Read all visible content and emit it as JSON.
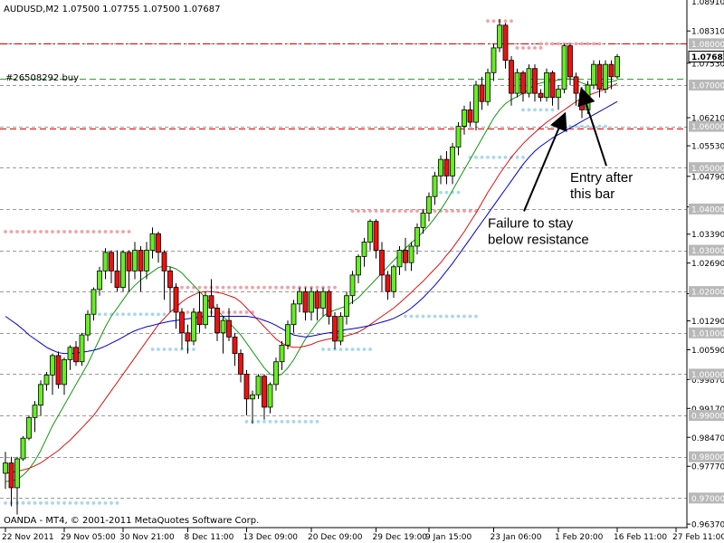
{
  "chart_data": {
    "type": "candlestick",
    "symbol_header": "AUDUSD,M2  1.07500 1.07755 1.07500 1.07687",
    "order_label": "#26508292 buy",
    "copyright": "OANDA - MT4, © 2001-2011 MetaQuotes Software Corp.",
    "ylim": [
      0.9635,
      1.0895
    ],
    "price_ticks": [
      "1.08310",
      "1.07530",
      "1.06210",
      "1.05530",
      "1.04790",
      "1.04050",
      "1.03390",
      "1.02690",
      "1.01950",
      "1.01290",
      "1.00590",
      "0.99870",
      "0.99170",
      "0.98470",
      "0.97770",
      "0.96370"
    ],
    "level_labels": [
      "1.08000",
      "1.07000",
      "1.06000",
      "1.05000",
      "1.04000",
      "1.03000",
      "1.02000",
      "1.01000",
      "1.00000",
      "0.99000",
      "0.98000",
      "0.97000"
    ],
    "current_price": "1.07687",
    "top_cut_label": "1.08910",
    "date_labels": [
      "22 Nov 2011",
      "29 Nov 05:00",
      "30 Nov 21:00",
      "8 Dec 11:00",
      "13 Dec 09:00",
      "20 Dec 09:00",
      "29 Dec 19:00",
      "9 Jan 15:00",
      "23 Jan 06:00",
      "1 Feb 20:00",
      "16 Feb 11:00",
      "27 Feb 11:00"
    ],
    "date_label_bars": [
      0,
      10,
      20,
      31,
      41,
      52,
      63,
      72,
      83,
      94,
      104,
      114
    ],
    "horizontal_levels": [
      {
        "price": 1.08,
        "style": "dashdot",
        "color": "#cc0000"
      },
      {
        "price": 1.0715,
        "style": "dashed",
        "color": "#22aa22"
      },
      {
        "price": 1.0595,
        "style": "dashed",
        "color": "#dd0000"
      }
    ],
    "candles": [
      [
        0.976,
        0.9812,
        0.9722,
        0.9785
      ],
      [
        0.9785,
        0.98,
        0.968,
        0.9725
      ],
      [
        0.9725,
        0.98,
        0.966,
        0.9795
      ],
      [
        0.9795,
        0.985,
        0.979,
        0.9845
      ],
      [
        0.9845,
        0.99,
        0.984,
        0.9895
      ],
      [
        0.9895,
        0.9935,
        0.986,
        0.9925
      ],
      [
        0.9925,
        0.9985,
        0.99,
        0.9975
      ],
      [
        0.9975,
        1.0005,
        0.996,
        0.9998
      ],
      [
        0.9998,
        1.005,
        0.995,
        1.0045
      ],
      [
        1.0045,
        1.0055,
        0.9965,
        0.9975
      ],
      [
        0.9975,
        1.004,
        0.995,
        1.0035
      ],
      [
        1.0035,
        1.007,
        1.001,
        1.0065
      ],
      [
        1.0065,
        1.008,
        1.002,
        1.003
      ],
      [
        1.003,
        1.01,
        1.002,
        1.0095
      ],
      [
        1.0095,
        1.0155,
        1.008,
        1.0145
      ],
      [
        1.0145,
        1.021,
        1.013,
        1.0205
      ],
      [
        1.0205,
        1.026,
        1.019,
        1.025
      ],
      [
        1.025,
        1.0305,
        1.023,
        1.0295
      ],
      [
        1.0295,
        1.03,
        1.022,
        1.025
      ],
      [
        1.025,
        1.03,
        1.02,
        1.021
      ],
      [
        1.021,
        1.03,
        1.02,
        1.0295
      ],
      [
        1.0295,
        1.03,
        1.02,
        1.025
      ],
      [
        1.025,
        1.032,
        1.023,
        1.03
      ],
      [
        1.03,
        1.031,
        1.02,
        1.025
      ],
      [
        1.025,
        1.032,
        1.023,
        1.03
      ],
      [
        1.03,
        1.0355,
        1.028,
        1.034
      ],
      [
        1.034,
        1.0345,
        1.027,
        1.0295
      ],
      [
        1.0295,
        1.03,
        1.018,
        1.025
      ],
      [
        1.025,
        1.026,
        1.015,
        1.021
      ],
      [
        1.021,
        1.022,
        1.011,
        1.015
      ],
      [
        1.015,
        1.016,
        1.006,
        1.01
      ],
      [
        1.01,
        1.012,
        1.005,
        1.008
      ],
      [
        1.008,
        1.016,
        1.007,
        1.015
      ],
      [
        1.015,
        1.02,
        1.01,
        1.012
      ],
      [
        1.012,
        1.02,
        1.011,
        1.019
      ],
      [
        1.019,
        1.023,
        1.014,
        1.016
      ],
      [
        1.016,
        1.017,
        1.008,
        1.01
      ],
      [
        1.01,
        1.014,
        1.005,
        1.013
      ],
      [
        1.013,
        1.016,
        1.008,
        1.009
      ],
      [
        1.009,
        1.01,
        1.002,
        1.005
      ],
      [
        1.005,
        1.006,
        0.998,
        1.0
      ],
      [
        1.0,
        1.001,
        0.99,
        0.994
      ],
      [
        0.994,
        0.996,
        0.988,
        0.995
      ],
      [
        0.995,
        1.0,
        0.994,
        0.9995
      ],
      [
        0.9995,
        1.0,
        0.989,
        0.992
      ],
      [
        0.992,
        0.998,
        0.9905,
        0.9975
      ],
      [
        0.9975,
        1.004,
        0.996,
        1.003
      ],
      [
        1.003,
        1.008,
        1.001,
        1.007
      ],
      [
        1.007,
        1.013,
        1.006,
        1.012
      ],
      [
        1.012,
        1.018,
        1.01,
        1.017
      ],
      [
        1.017,
        1.021,
        1.015,
        1.02
      ],
      [
        1.02,
        1.021,
        1.013,
        1.015
      ],
      [
        1.015,
        1.021,
        1.013,
        1.02
      ],
      [
        1.02,
        1.0205,
        1.013,
        1.016
      ],
      [
        1.016,
        1.021,
        1.014,
        1.02
      ],
      [
        1.02,
        1.0205,
        1.012,
        1.014
      ],
      [
        1.014,
        1.015,
        1.006,
        1.008
      ],
      [
        1.008,
        1.015,
        1.007,
        1.014
      ],
      [
        1.014,
        1.02,
        1.012,
        1.019
      ],
      [
        1.019,
        1.025,
        1.017,
        1.024
      ],
      [
        1.024,
        1.029,
        1.022,
        1.0285
      ],
      [
        1.0285,
        1.033,
        1.026,
        1.032
      ],
      [
        1.032,
        1.0375,
        1.03,
        1.037
      ],
      [
        1.037,
        1.0375,
        1.028,
        1.03
      ],
      [
        1.03,
        1.032,
        1.02,
        1.024
      ],
      [
        1.024,
        1.025,
        1.018,
        1.02
      ],
      [
        1.02,
        1.0265,
        1.0185,
        1.026
      ],
      [
        1.026,
        1.031,
        1.024,
        1.03
      ],
      [
        1.03,
        1.033,
        1.025,
        1.027
      ],
      [
        1.027,
        1.032,
        1.025,
        1.031
      ],
      [
        1.031,
        1.0365,
        1.029,
        1.0355
      ],
      [
        1.0355,
        1.04,
        1.034,
        1.039
      ],
      [
        1.039,
        1.044,
        1.037,
        1.043
      ],
      [
        1.043,
        1.049,
        1.041,
        1.048
      ],
      [
        1.048,
        1.053,
        1.046,
        1.052
      ],
      [
        1.052,
        1.054,
        1.046,
        1.048
      ],
      [
        1.048,
        1.056,
        1.046,
        1.055
      ],
      [
        1.055,
        1.061,
        1.053,
        1.06
      ],
      [
        1.06,
        1.065,
        1.058,
        1.064
      ],
      [
        1.064,
        1.066,
        1.06,
        1.061
      ],
      [
        1.061,
        1.071,
        1.059,
        1.07
      ],
      [
        1.07,
        1.072,
        1.064,
        1.066
      ],
      [
        1.066,
        1.074,
        1.065,
        1.073
      ],
      [
        1.073,
        1.08,
        1.071,
        1.079
      ],
      [
        1.079,
        1.086,
        1.078,
        1.0845
      ],
      [
        1.0845,
        1.085,
        1.074,
        1.076
      ],
      [
        1.076,
        1.077,
        1.065,
        1.068
      ],
      [
        1.068,
        1.074,
        1.067,
        1.073
      ],
      [
        1.073,
        1.0735,
        1.066,
        1.068
      ],
      [
        1.068,
        1.075,
        1.067,
        1.074
      ],
      [
        1.074,
        1.075,
        1.066,
        1.068
      ],
      [
        1.068,
        1.069,
        1.066,
        1.067
      ],
      [
        1.067,
        1.074,
        1.066,
        1.073
      ],
      [
        1.073,
        1.0735,
        1.065,
        1.067
      ],
      [
        1.067,
        1.07,
        1.064,
        1.069
      ],
      [
        1.069,
        1.08,
        1.068,
        1.0795
      ],
      [
        1.0795,
        1.08,
        1.07,
        1.072
      ],
      [
        1.072,
        1.073,
        1.065,
        1.068
      ],
      [
        1.068,
        1.0695,
        1.062,
        1.064
      ],
      [
        1.064,
        1.071,
        1.063,
        1.07
      ],
      [
        1.07,
        1.076,
        1.069,
        1.075
      ],
      [
        1.075,
        1.076,
        1.067,
        1.069
      ],
      [
        1.069,
        1.076,
        1.068,
        1.075
      ],
      [
        1.075,
        1.076,
        1.069,
        1.072
      ],
      [
        1.072,
        1.0775,
        1.0715,
        1.0769
      ]
    ],
    "ma_series": [
      {
        "color": "#119911",
        "values": [
          0.974,
          0.9742,
          0.9745,
          0.9755,
          0.977,
          0.979,
          0.9815,
          0.9845,
          0.9875,
          0.99,
          0.9925,
          0.995,
          0.9975,
          1.0,
          1.0025,
          1.0055,
          1.0085,
          1.0115,
          1.014,
          1.016,
          1.018,
          1.02,
          1.0215,
          1.0228,
          1.0238,
          1.0248,
          1.0258,
          1.0262,
          1.026,
          1.0255,
          1.0245,
          1.023,
          1.0215,
          1.02,
          1.0185,
          1.017,
          1.0155,
          1.014,
          1.0125,
          1.011,
          1.0095,
          1.0075,
          1.0055,
          1.0035,
          1.0015,
          1.0,
          0.9995,
          1.0,
          1.0015,
          1.0035,
          1.006,
          1.0085,
          1.0105,
          1.0125,
          1.014,
          1.015,
          1.0155,
          1.016,
          1.0165,
          1.0175,
          1.0185,
          1.02,
          1.0215,
          1.023,
          1.0245,
          1.026,
          1.0275,
          1.029,
          1.0305,
          1.0318,
          1.033,
          1.0345,
          1.036,
          1.0378,
          1.0398,
          1.042,
          1.0445,
          1.047,
          1.0495,
          1.052,
          1.0545,
          1.057,
          1.0595,
          1.062,
          1.064,
          1.0655,
          1.0665,
          1.0672,
          1.068,
          1.069,
          1.07,
          1.0705,
          1.0708,
          1.071,
          1.0712,
          1.0715,
          1.0715,
          1.0712,
          1.0705,
          1.07,
          1.07,
          1.0702,
          1.0705,
          1.0708,
          1.0712
        ]
      },
      {
        "color": "#dd1111",
        "values": [
          0.976,
          0.9762,
          0.9765,
          0.9768,
          0.9772,
          0.9778,
          0.9785,
          0.9795,
          0.9805,
          0.9815,
          0.9828,
          0.984,
          0.9855,
          0.987,
          0.9885,
          0.99,
          0.992,
          0.994,
          0.996,
          0.998,
          1.0,
          1.002,
          1.004,
          1.006,
          1.008,
          1.01,
          1.012,
          1.0135,
          1.015,
          1.0162,
          1.0175,
          1.0185,
          1.0192,
          1.0198,
          1.02,
          1.02,
          1.0198,
          1.0195,
          1.019,
          1.0185,
          1.0175,
          1.016,
          1.0145,
          1.013,
          1.0115,
          1.01,
          1.0085,
          1.0075,
          1.0068,
          1.0065,
          1.0065,
          1.0068,
          1.0072,
          1.0078,
          1.0082,
          1.0085,
          1.0088,
          1.009,
          1.0093,
          1.0097,
          1.0102,
          1.011,
          1.012,
          1.013,
          1.014,
          1.015,
          1.016,
          1.0172,
          1.0185,
          1.0198,
          1.0212,
          1.0225,
          1.024,
          1.0255,
          1.027,
          1.0288,
          1.0305,
          1.0325,
          1.0345,
          1.0368,
          1.039,
          1.0415,
          1.044,
          1.0462,
          1.0485,
          1.0505,
          1.0525,
          1.0542,
          1.0558,
          1.0572,
          1.0585,
          1.0598,
          1.061,
          1.062,
          1.063,
          1.064,
          1.065,
          1.066,
          1.0668,
          1.0675,
          1.068,
          1.0685,
          1.069,
          1.0697,
          1.0704
        ]
      },
      {
        "color": "#0000cc",
        "values": [
          1.014,
          1.013,
          1.012,
          1.0108,
          1.0095,
          1.0085,
          1.0075,
          1.0065,
          1.0058,
          1.0052,
          1.005,
          1.005,
          1.0051,
          1.0053,
          1.0055,
          1.0058,
          1.0062,
          1.0068,
          1.0075,
          1.0082,
          1.009,
          1.0098,
          1.0105,
          1.011,
          1.0115,
          1.0118,
          1.0122,
          1.0125,
          1.0128,
          1.013,
          1.0132,
          1.0134,
          1.0136,
          1.0138,
          1.014,
          1.014,
          1.014,
          1.014,
          1.014,
          1.014,
          1.014,
          1.014,
          1.0138,
          1.0135,
          1.013,
          1.0125,
          1.0118,
          1.011,
          1.0102,
          1.0095,
          1.0092,
          1.009,
          1.0092,
          1.0095,
          1.0098,
          1.01,
          1.0102,
          1.0105,
          1.0108,
          1.011,
          1.0112,
          1.0115,
          1.0118,
          1.0122,
          1.0126,
          1.013,
          1.0135,
          1.0142,
          1.015,
          1.016,
          1.0172,
          1.0185,
          1.02,
          1.0215,
          1.0232,
          1.025,
          1.0268,
          1.0288,
          1.0308,
          1.0328,
          1.0348,
          1.0368,
          1.0388,
          1.0408,
          1.0428,
          1.0448,
          1.0468,
          1.0488,
          1.0508,
          1.0525,
          1.054,
          1.0552,
          1.0562,
          1.0572,
          1.058,
          1.0588,
          1.0596,
          1.0604,
          1.0612,
          1.062,
          1.0628,
          1.0636,
          1.0644,
          1.0652,
          1.066
        ]
      }
    ],
    "dotted_levels": [
      {
        "price": 1.0345,
        "from": 0,
        "to": 21,
        "color": "#f4a0a8"
      },
      {
        "price": 1.0145,
        "from": 16,
        "to": 27,
        "color": "#a8d8ea"
      },
      {
        "price": 1.021,
        "from": 28,
        "to": 50,
        "color": "#f4a0a8"
      },
      {
        "price": 1.006,
        "from": 25,
        "to": 32,
        "color": "#a8d8ea"
      },
      {
        "price": 1.015,
        "from": 30,
        "to": 42,
        "color": "#f4a0a8"
      },
      {
        "price": 0.9885,
        "from": 41,
        "to": 53,
        "color": "#a8d8ea"
      },
      {
        "price": 1.021,
        "from": 48,
        "to": 56,
        "color": "#f4a0a8"
      },
      {
        "price": 1.006,
        "from": 54,
        "to": 62,
        "color": "#a8d8ea"
      },
      {
        "price": 1.0395,
        "from": 59,
        "to": 80,
        "color": "#f4a0a8"
      },
      {
        "price": 1.014,
        "from": 68,
        "to": 80,
        "color": "#a8d8ea"
      },
      {
        "price": 1.044,
        "from": 73,
        "to": 77,
        "color": "#a8d8ea"
      },
      {
        "price": 1.0525,
        "from": 79,
        "to": 88,
        "color": "#a8d8ea"
      },
      {
        "price": 1.0855,
        "from": 82,
        "to": 86,
        "color": "#f4a0a8"
      },
      {
        "price": 1.079,
        "from": 87,
        "to": 91,
        "color": "#f4a0a8"
      },
      {
        "price": 1.08,
        "from": 91,
        "to": 101,
        "color": "#f4a0a8"
      },
      {
        "price": 1.064,
        "from": 88,
        "to": 93,
        "color": "#a8d8ea"
      },
      {
        "price": 1.06,
        "from": 96,
        "to": 102,
        "color": "#a8d8ea"
      },
      {
        "price": 0.9688,
        "from": 0,
        "to": 19,
        "color": "#a8d8ea"
      }
    ],
    "annotations": [
      {
        "lines": [
          "Entry after",
          "this bar"
        ],
        "anchor_bar": 98,
        "anchor_price": 1.07,
        "text_bar": 96,
        "text_price": 1.0465
      },
      {
        "lines": [
          "Failure to stay",
          "below resistance"
        ],
        "anchor_bar": 95,
        "anchor_price": 1.064,
        "text_bar": 82,
        "text_price": 1.0355
      }
    ]
  }
}
